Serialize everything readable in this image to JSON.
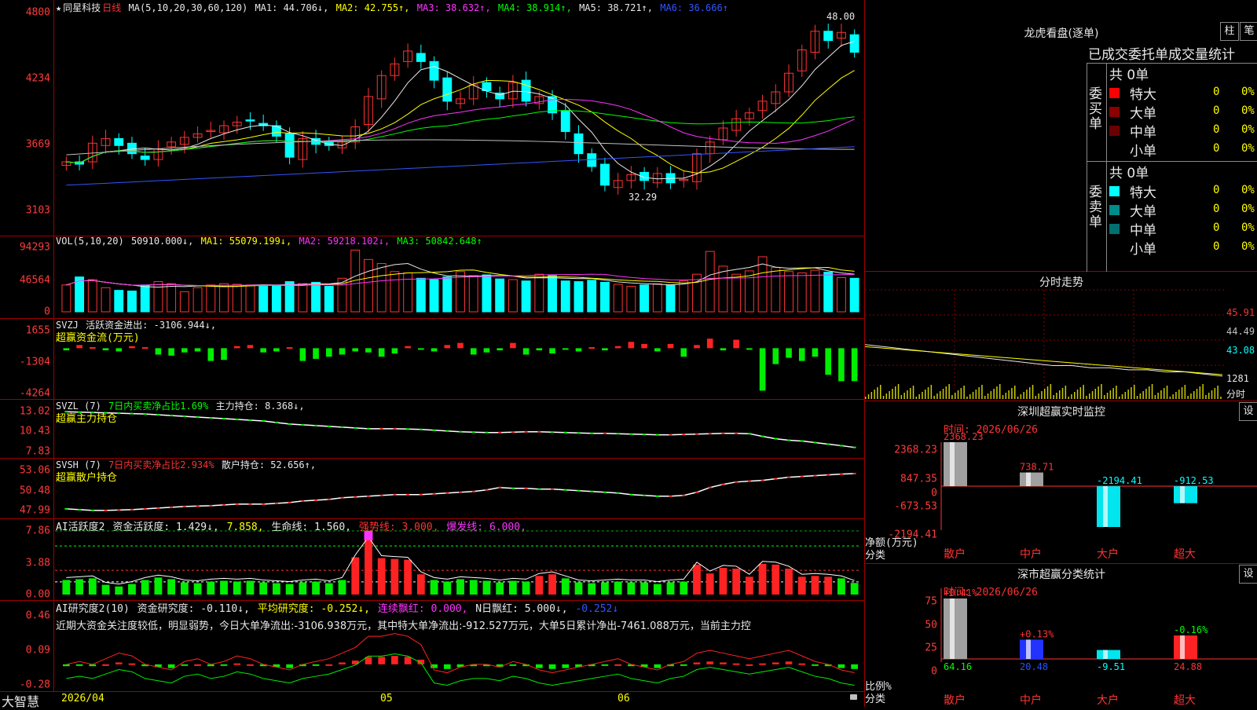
{
  "header": {
    "star": "★",
    "stock_name": "同星科技",
    "period": "日线",
    "ma_label": "MA(5,10,20,30,60,120)",
    "ma1": "MA1: 44.706↓,",
    "ma2": "MA2: 42.755↑,",
    "ma3": "MA3: 38.632↑,",
    "ma4": "MA4: 38.914↑,",
    "ma5": "MA5: 38.721↑,",
    "ma6": "MA6: 36.666↑",
    "high_label": "48.00",
    "low_label": "32.29"
  },
  "price_axis": [
    "4800",
    "4234",
    "3669",
    "3103"
  ],
  "vol_panel": {
    "title": "VOL(5,10,20)",
    "value": "50910.000↓,",
    "ma1": "MA1: 55079.199↓,",
    "ma2": "MA2: 59218.102↓,",
    "ma3": "MA3: 50842.648↑",
    "ticks": [
      "94293",
      "46564",
      "0"
    ]
  },
  "svzj_panel": {
    "title": "SVZJ",
    "desc": "活跃资金进出: -3106.944↓,",
    "sub": "超赢资金流(万元)",
    "ticks": [
      "1655",
      "-1304",
      "-4264"
    ]
  },
  "svzl_panel": {
    "title": "SVZL (7)",
    "desc": "7日内买卖净占比1.69%",
    "main": "主力持仓: 8.368↓,",
    "sub": "超赢主力持仓",
    "ticks": [
      "13.02",
      "10.43",
      "7.83"
    ]
  },
  "svsh_panel": {
    "title": "SVSH (7)",
    "desc": "7日内买卖净占比2.934%",
    "main": "散户持仓: 52.656↑,",
    "sub": "超赢散户持仓",
    "ticks": [
      "53.06",
      "50.48",
      "47.99"
    ]
  },
  "ai_active_panel": {
    "title": "AI活跃度2",
    "a": "资金活跃度: 1.429↓,",
    "b": "7.858,",
    "c": "生命线: 1.560,",
    "d": "强势线: 3.000,",
    "e": "爆发线: 6.000,",
    "ticks": [
      "7.86",
      "3.88",
      "0.00"
    ]
  },
  "ai_research_panel": {
    "title": "AI研究度2(10)",
    "a": "资金研究度: -0.110↓,",
    "b": "平均研究度: -0.252↓,",
    "c": "连续飘红: 0.000,",
    "d": "N日飘红: 5.000↓,",
    "e": "-0.252↓",
    "commentary": "近期大资金关注度较低，明显弱势，今日大单净流出:-3106.938万元，其中特大单净流出:-912.527万元，大单5日累计净出-7461.088万元，当前主力控",
    "ticks": [
      "0.46",
      "0.09",
      "-0.28"
    ]
  },
  "bottom": {
    "brand": "大智慧",
    "date": "2026/04",
    "m05": "05",
    "m06": "06"
  },
  "right": {
    "dragon_title": "龙虎看盘(逐单)",
    "btn_zhu": "柱",
    "btn_bi": "笔",
    "stat_header": "已成交委托单成交量统计",
    "buy_label": "委买单",
    "sell_label": "委卖单",
    "buy_total": "共 0单",
    "sell_total": "共 0单",
    "buy_rows": [
      {
        "name": "特大",
        "count": "0",
        "pct": "0%",
        "color": "#ff0000"
      },
      {
        "name": "大单",
        "count": "0",
        "pct": "0%",
        "color": "#8b0000"
      },
      {
        "name": "中单",
        "count": "0",
        "pct": "0%",
        "color": "#6b0000"
      },
      {
        "name": "小单",
        "count": "0",
        "pct": "0%",
        "color": "#000000"
      }
    ],
    "sell_rows": [
      {
        "name": "特大",
        "count": "0",
        "pct": "0%",
        "color": "#00ffff"
      },
      {
        "name": "大单",
        "count": "0",
        "pct": "0%",
        "color": "#008b8b"
      },
      {
        "name": "中单",
        "count": "0",
        "pct": "0%",
        "color": "#007070"
      },
      {
        "name": "小单",
        "count": "0",
        "pct": "0%",
        "color": "#000000"
      }
    ],
    "intraday_title": "分时走势",
    "intraday_ticks": [
      "45.91",
      "44.49",
      "43.08",
      "1281",
      "分时"
    ],
    "sz_monitor_title": "深圳超赢实时监控",
    "sz_monitor_time": "时间: 2026/06/26",
    "sz_monitor_btn": "设",
    "monitor_ticks": [
      "2368.23",
      "847.35",
      "0",
      "-673.53",
      "-2194.41"
    ],
    "monitor_ylabel": "净额(万元)",
    "monitor_xlabel": "分类",
    "monitor_cats": [
      "散户",
      "中户",
      "大户",
      "超大"
    ],
    "monitor_values": [
      "2368.23",
      "738.71",
      "-2194.41",
      "-912.53"
    ],
    "sz_class_title": "深市超赢分类统计",
    "sz_class_time": "时间: 2026/06/26",
    "sz_class_btn": "设",
    "class_ticks": [
      "75",
      "50",
      "25",
      "0"
    ],
    "class_ylabel": "比例%",
    "class_xlabel": "分类",
    "class_cats": [
      "散户",
      "中户",
      "大户",
      "超大"
    ],
    "class_pct": [
      "+0.41%",
      "+0.13%",
      "",
      "-0.16%"
    ],
    "class_values": [
      "64.16",
      "20.48",
      "-9.51",
      "24.88"
    ]
  },
  "chart_data": {
    "type": "candlestick",
    "title": "同星科技 日线",
    "period_labels": [
      "2026/04",
      "05",
      "06"
    ],
    "price_range": [
      31.03,
      48.0
    ],
    "high": 48.0,
    "low": 32.29,
    "closes": [
      35.2,
      35.0,
      36.8,
      37.2,
      36.6,
      35.9,
      35.4,
      36.3,
      36.9,
      37.3,
      37.6,
      37.9,
      38.3,
      38.6,
      38.7,
      38.3,
      37.4,
      35.6,
      37.2,
      36.7,
      36.6,
      36.9,
      38.2,
      40.8,
      42.6,
      43.6,
      44.7,
      43.8,
      42.2,
      40.4,
      40.6,
      41.8,
      41.3,
      40.6,
      42.0,
      40.4,
      40.8,
      39.4,
      37.8,
      35.9,
      34.8,
      33.2,
      33.6,
      34.1,
      33.6,
      34.2,
      33.4,
      33.7,
      35.9,
      36.9,
      38.1,
      38.9,
      39.4,
      40.4,
      41.2,
      42.8,
      44.8,
      46.4,
      45.6,
      46.3,
      44.6
    ],
    "volumes": [
      40000,
      52000,
      48000,
      36000,
      32000,
      31000,
      40000,
      45000,
      42000,
      30000,
      36000,
      40000,
      42000,
      41000,
      40000,
      38000,
      39000,
      45000,
      42000,
      44000,
      38000,
      50000,
      92000,
      78000,
      72000,
      60000,
      58000,
      50000,
      48000,
      52000,
      60000,
      54000,
      55000,
      49000,
      48000,
      46000,
      56000,
      54000,
      46000,
      45000,
      47000,
      44000,
      41000,
      38000,
      40000,
      42000,
      40000,
      46000,
      56000,
      90000,
      68000,
      56000,
      61000,
      82000,
      66000,
      60000,
      58000,
      62000,
      59000,
      50910,
      50000
    ],
    "svzj": [
      -200,
      300,
      100,
      -200,
      -300,
      200,
      100,
      -600,
      -700,
      -400,
      -300,
      -1200,
      -1100,
      200,
      300,
      -400,
      -300,
      100,
      -1200,
      -1000,
      -800,
      -600,
      -300,
      -400,
      -800,
      -500,
      200,
      -100,
      -300,
      300,
      500,
      -600,
      -400,
      -200,
      500,
      -600,
      -200,
      -500,
      -100,
      -300,
      100,
      -200,
      200,
      600,
      400,
      -300,
      400,
      -800,
      300,
      900,
      -200,
      800,
      -100,
      -4000,
      -1500,
      -900,
      -1200,
      -800,
      -2500,
      -3107,
      -3100
    ],
    "svzl": [
      13.0,
      12.95,
      12.9,
      12.85,
      12.8,
      12.75,
      12.7,
      12.6,
      12.5,
      12.4,
      12.3,
      12.2,
      12.1,
      12.0,
      11.9,
      11.8,
      11.6,
      11.4,
      11.3,
      11.2,
      11.1,
      11.0,
      10.9,
      10.8,
      10.8,
      10.8,
      10.75,
      10.7,
      10.6,
      10.5,
      10.4,
      10.35,
      10.3,
      10.3,
      10.35,
      10.4,
      10.4,
      10.35,
      10.3,
      10.25,
      10.2,
      10.2,
      10.15,
      10.1,
      10.05,
      10.0,
      10.0,
      10.05,
      10.1,
      10.15,
      10.2,
      10.2,
      10.15,
      9.8,
      9.5,
      9.3,
      9.2,
      9.0,
      8.8,
      8.6,
      8.37
    ],
    "svsh": [
      48.2,
      48.1,
      48.0,
      48.0,
      48.05,
      48.1,
      48.2,
      48.3,
      48.4,
      48.5,
      48.55,
      48.6,
      48.7,
      48.8,
      48.8,
      48.8,
      48.9,
      49.0,
      49.2,
      49.3,
      49.4,
      49.6,
      49.7,
      49.8,
      49.9,
      50.0,
      50.0,
      50.0,
      50.1,
      50.2,
      50.3,
      50.4,
      50.6,
      50.9,
      50.8,
      50.8,
      50.7,
      50.7,
      50.6,
      50.5,
      50.4,
      50.3,
      50.2,
      50.0,
      49.9,
      49.8,
      49.8,
      49.9,
      50.3,
      50.9,
      51.3,
      51.6,
      51.7,
      51.8,
      52.0,
      52.2,
      52.3,
      52.4,
      52.5,
      52.6,
      52.66
    ],
    "active": [
      1.8,
      1.9,
      2.0,
      1.2,
      1.0,
      1.3,
      1.8,
      2.1,
      1.9,
      1.5,
      1.4,
      1.6,
      1.7,
      1.6,
      1.7,
      1.5,
      1.4,
      1.3,
      1.5,
      1.6,
      1.4,
      1.8,
      4.6,
      6.8,
      4.5,
      4.4,
      4.3,
      2.5,
      1.8,
      1.6,
      1.9,
      1.8,
      1.7,
      1.5,
      1.7,
      1.6,
      2.3,
      2.5,
      2.0,
      1.5,
      1.4,
      1.5,
      1.6,
      1.5,
      1.5,
      1.3,
      1.5,
      1.6,
      3.7,
      2.6,
      3.3,
      3.2,
      2.2,
      3.8,
      3.7,
      3.2,
      2.2,
      2.3,
      2.2,
      2.0,
      1.43
    ],
    "research": [
      -0.08,
      -0.07,
      -0.08,
      -0.06,
      -0.04,
      -0.05,
      -0.08,
      -0.09,
      -0.1,
      -0.07,
      -0.06,
      -0.08,
      -0.07,
      -0.05,
      -0.06,
      -0.08,
      -0.09,
      -0.1,
      -0.08,
      -0.07,
      -0.06,
      -0.04,
      -0.02,
      0.02,
      0.02,
      0.03,
      0.02,
      -0.01,
      -0.1,
      -0.11,
      -0.09,
      -0.08,
      -0.08,
      -0.09,
      -0.07,
      -0.08,
      -0.1,
      -0.11,
      -0.1,
      -0.09,
      -0.08,
      -0.07,
      -0.06,
      -0.08,
      -0.09,
      -0.1,
      -0.08,
      -0.07,
      -0.04,
      -0.03,
      -0.04,
      -0.05,
      -0.06,
      -0.05,
      -0.04,
      -0.03,
      -0.05,
      -0.07,
      -0.08,
      -0.1,
      -0.11
    ],
    "intraday": [
      43.6,
      43.5,
      43.4,
      43.3,
      43.2,
      43.1,
      43.0,
      42.9,
      42.8,
      42.7,
      42.6,
      42.6,
      42.5,
      42.5,
      42.4,
      42.4,
      42.3,
      42.3,
      42.2,
      42.1
    ],
    "monitor": {
      "categories": [
        "散户",
        "中户",
        "大户",
        "超大"
      ],
      "values": [
        2368.23,
        738.71,
        -2194.41,
        -912.53
      ],
      "ylim": [
        -2194.41,
        2368.23
      ]
    },
    "classification": {
      "categories": [
        "散户",
        "中户",
        "大户",
        "超大"
      ],
      "values": [
        64.16,
        20.48,
        -9.51,
        24.88
      ],
      "pct": [
        "+0.41%",
        "+0.13%",
        "",
        "-0.16%"
      ],
      "ylim": [
        0,
        75
      ]
    }
  }
}
